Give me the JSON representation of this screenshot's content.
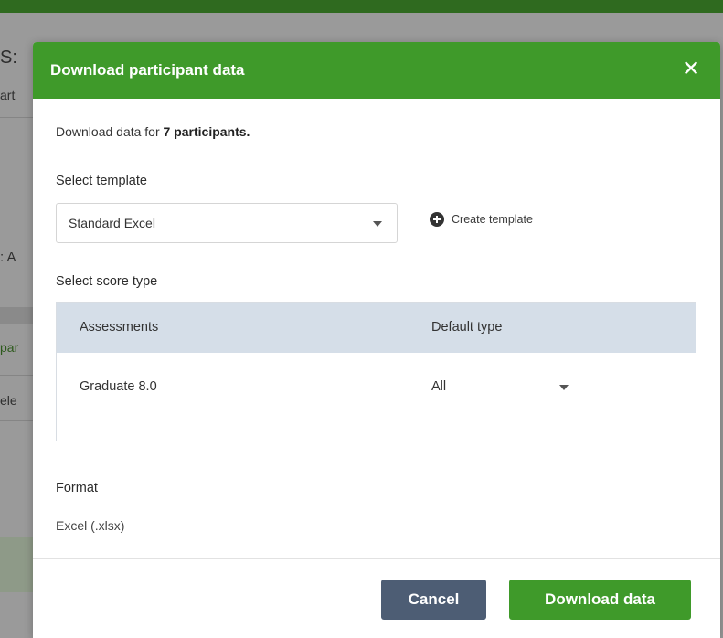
{
  "background": {
    "fragments": [
      "S:",
      "art",
      ": A",
      "par",
      "ele"
    ]
  },
  "modal": {
    "title": "Download participant data",
    "close_icon": "close-icon",
    "intro_prefix": "Download data for ",
    "intro_bold": "7 participants.",
    "select_template_label": "Select template",
    "template_value": "Standard Excel",
    "create_template_label": "Create template",
    "create_template_icon": "plus-circle-icon",
    "select_score_label": "Select score type",
    "score_table": {
      "headers": [
        "Assessments",
        "Default type"
      ],
      "rows": [
        {
          "assessment": "Graduate 8.0",
          "type": "All"
        }
      ]
    },
    "format_label": "Format",
    "format_value": "Excel (.xlsx)",
    "cancel_label": "Cancel",
    "download_label": "Download data"
  },
  "colors": {
    "header_green": "#3f9a2a",
    "button_green": "#3f9a2a",
    "cancel_slate": "#4d5d74",
    "table_header": "#d5dee8"
  }
}
